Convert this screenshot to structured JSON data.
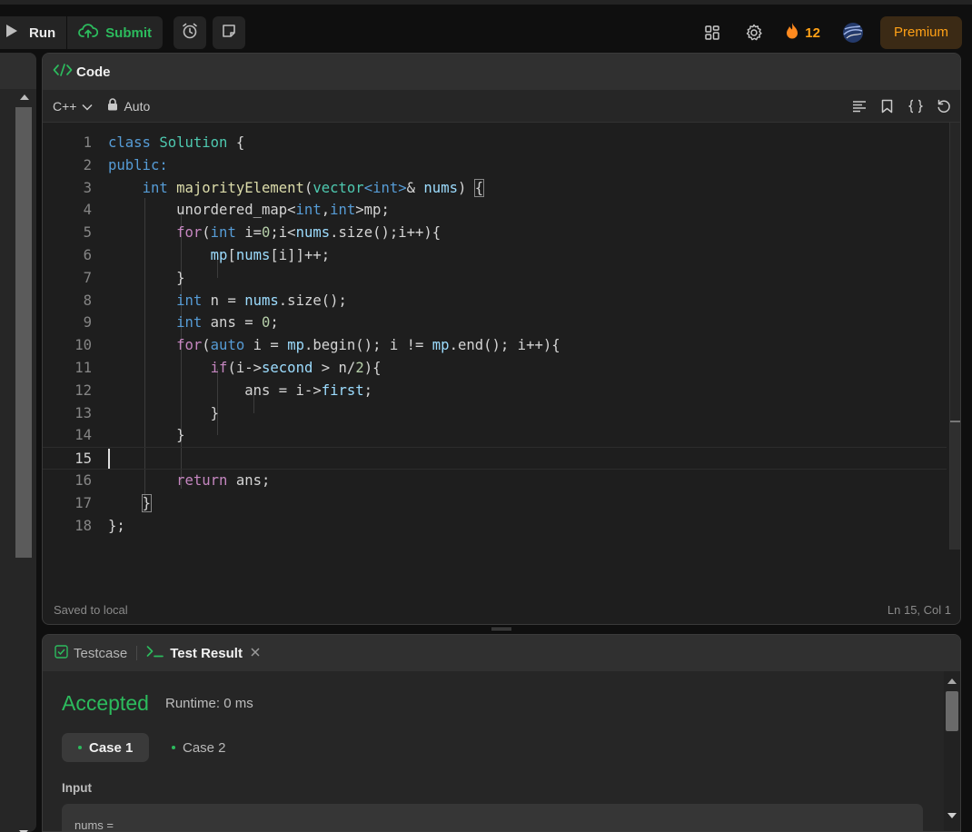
{
  "topbar": {
    "run_label": "Run",
    "submit_label": "Submit",
    "streak_count": "12",
    "premium_label": "Premium"
  },
  "code_panel": {
    "title": "Code",
    "language": "C++",
    "mode": "Auto",
    "status_left": "Saved to local",
    "status_right": "Ln 15, Col 1",
    "active_line": 15,
    "lines": [
      "class Solution {",
      "public:",
      "    int majorityElement(vector<int>& nums) {",
      "        unordered_map<int,int>mp;",
      "        for(int i=0;i<nums.size();i++){",
      "            mp[nums[i]]++;",
      "        }",
      "        int n = nums.size();",
      "        int ans = 0;",
      "        for(auto i = mp.begin(); i != mp.end(); i++){",
      "            if(i->second > n/2){",
      "                ans = i->first;",
      "            }",
      "        }",
      "",
      "        return ans;",
      "    }",
      "};"
    ]
  },
  "result_panel": {
    "tab_testcase": "Testcase",
    "tab_result": "Test Result",
    "status": "Accepted",
    "runtime": "Runtime: 0 ms",
    "cases": [
      "Case 1",
      "Case 2"
    ],
    "input_label": "Input",
    "input_preview": "nums ="
  },
  "colors": {
    "accent_green": "#2cbb5d",
    "accent_orange": "#ffa116"
  }
}
